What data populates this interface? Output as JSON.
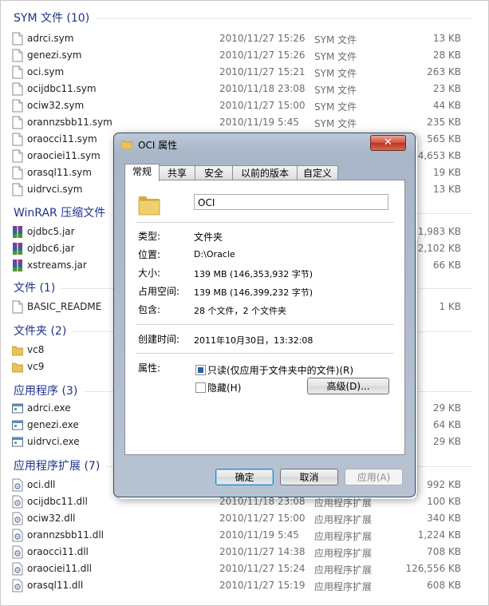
{
  "groups": [
    {
      "title": "SYM 文件 (10)",
      "icon": "document-icon",
      "items": [
        {
          "name": "adrci.sym",
          "date": "2010/11/27 15:26",
          "type": "SYM 文件",
          "size": "13 KB"
        },
        {
          "name": "genezi.sym",
          "date": "2010/11/27 15:26",
          "type": "SYM 文件",
          "size": "28 KB"
        },
        {
          "name": "oci.sym",
          "date": "2010/11/27 15:21",
          "type": "SYM 文件",
          "size": "263 KB"
        },
        {
          "name": "ocijdbc11.sym",
          "date": "2010/11/18 23:08",
          "type": "SYM 文件",
          "size": "23 KB"
        },
        {
          "name": "ociw32.sym",
          "date": "2010/11/27 15:00",
          "type": "SYM 文件",
          "size": "44 KB"
        },
        {
          "name": "orannzsbb11.sym",
          "date": "2010/11/19 5:45",
          "type": "SYM 文件",
          "size": "235 KB"
        },
        {
          "name": "oraocci11.sym",
          "date": "",
          "type": "",
          "size": "565 KB"
        },
        {
          "name": "oraociei11.sym",
          "date": "",
          "type": "",
          "size": "4,653 KB"
        },
        {
          "name": "orasql11.sym",
          "date": "",
          "type": "",
          "size": "19 KB"
        },
        {
          "name": "uidrvci.sym",
          "date": "",
          "type": "",
          "size": "13 KB"
        }
      ]
    },
    {
      "title": "WinRAR 压缩文件",
      "icon": "winrar-archive-icon",
      "items": [
        {
          "name": "ojdbc5.jar",
          "date": "",
          "type": "",
          "size": "1,983 KB"
        },
        {
          "name": "ojdbc6.jar",
          "date": "",
          "type": "",
          "size": "2,102 KB"
        },
        {
          "name": "xstreams.jar",
          "date": "",
          "type": "",
          "size": "66 KB"
        }
      ]
    },
    {
      "title": "文件 (1)",
      "icon": "document-icon",
      "items": [
        {
          "name": "BASIC_README",
          "date": "",
          "type": "",
          "size": "1 KB"
        }
      ]
    },
    {
      "title": "文件夹 (2)",
      "icon": "folder-icon",
      "items": [
        {
          "name": "vc8",
          "date": "",
          "type": "",
          "size": ""
        },
        {
          "name": "vc9",
          "date": "",
          "type": "",
          "size": ""
        }
      ]
    },
    {
      "title": "应用程序 (3)",
      "icon": "application-icon",
      "items": [
        {
          "name": "adrci.exe",
          "date": "",
          "type": "",
          "size": "29 KB"
        },
        {
          "name": "genezi.exe",
          "date": "",
          "type": "",
          "size": "64 KB"
        },
        {
          "name": "uidrvci.exe",
          "date": "",
          "type": "",
          "size": "29 KB"
        }
      ]
    },
    {
      "title": "应用程序扩展 (7)",
      "icon": "dll-icon",
      "items": [
        {
          "name": "oci.dll",
          "date": "",
          "type": "",
          "size": "992 KB"
        },
        {
          "name": "ocijdbc11.dll",
          "date": "2010/11/18 23:08",
          "type": "应用程序扩展",
          "size": "100 KB"
        },
        {
          "name": "ociw32.dll",
          "date": "2010/11/27 15:00",
          "type": "应用程序扩展",
          "size": "340 KB"
        },
        {
          "name": "orannzsbb11.dll",
          "date": "2010/11/19 5:45",
          "type": "应用程序扩展",
          "size": "1,224 KB"
        },
        {
          "name": "oraocci11.dll",
          "date": "2010/11/27 14:38",
          "type": "应用程序扩展",
          "size": "708 KB"
        },
        {
          "name": "oraociei11.dll",
          "date": "2010/11/27 15:24",
          "type": "应用程序扩展",
          "size": "126,556 KB"
        },
        {
          "name": "orasql11.dll",
          "date": "2010/11/27 15:19",
          "type": "应用程序扩展",
          "size": "608 KB"
        }
      ]
    }
  ],
  "dialog": {
    "title": "OCI 属性",
    "close_glyph": "✕",
    "tabs": [
      "常规",
      "共享",
      "安全",
      "以前的版本",
      "自定义"
    ],
    "active_tab": "常规",
    "folder_name": "OCI",
    "props": {
      "type_label": "类型:",
      "type_value": "文件夹",
      "location_label": "位置:",
      "location_value": "D:\\Oracle",
      "size_label": "大小:",
      "size_value": "139 MB (146,353,932 字节)",
      "disk_label": "占用空间:",
      "disk_value": "139 MB (146,399,232 字节)",
      "contains_label": "包含:",
      "contains_value": "28 个文件，2 个文件夹",
      "created_label": "创建时间:",
      "created_value": "2011年10月30日，13:32:08",
      "attr_label": "属性:"
    },
    "attributes": {
      "readonly_label": "只读(仅应用于文件夹中的文件)(R)",
      "readonly_state": "mixed",
      "hidden_label": "隐藏(H)",
      "hidden_checked": false,
      "advanced_label": "高级(D)..."
    },
    "buttons": {
      "ok": "确定",
      "cancel": "取消",
      "apply": "应用(A)"
    }
  },
  "colors": {
    "group_title": "#1e3287",
    "accent": "#2b61a8"
  }
}
